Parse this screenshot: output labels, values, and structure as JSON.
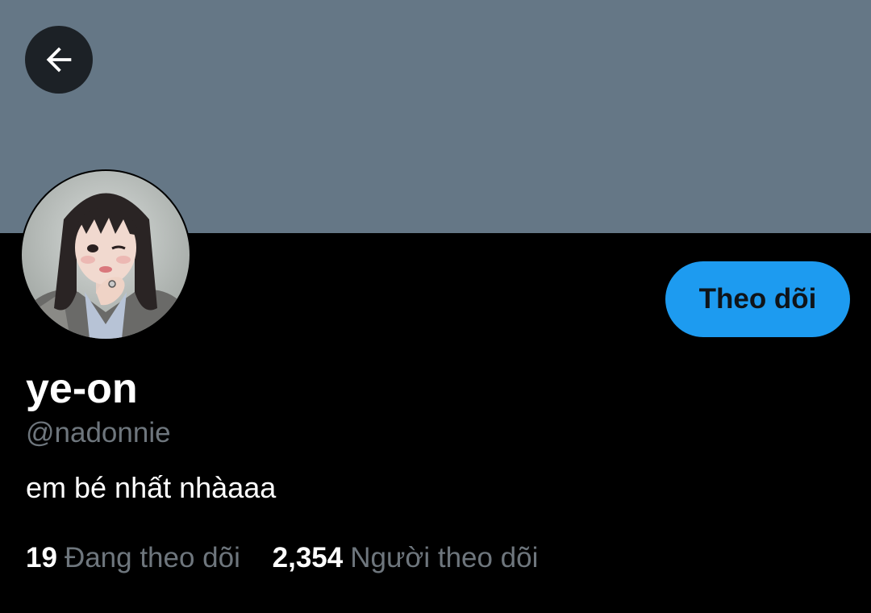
{
  "profile": {
    "display_name": "ye-on",
    "handle": "@nadonnie",
    "bio": "em bé nhất nhàaaa",
    "follow_label": "Theo dõi",
    "stats": {
      "following_count": "19",
      "following_label": "Đang theo dõi",
      "followers_count": "2,354",
      "followers_label": "Người theo dõi"
    }
  },
  "icons": {
    "back": "arrow-left-icon"
  },
  "colors": {
    "banner": "#657786",
    "accent": "#1d9bf0",
    "background": "#000000",
    "muted_text": "#6e767d"
  }
}
